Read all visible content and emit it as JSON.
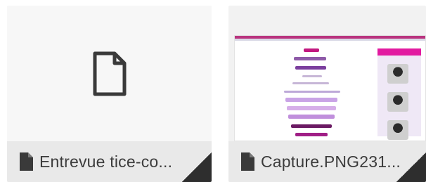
{
  "files": [
    {
      "name": "Entrevue tice-co...",
      "kind": "generic-document",
      "thumbnail_icon": "blank-file-icon",
      "type_icon": "file-icon"
    },
    {
      "name": "Capture.PNG231...",
      "kind": "image-preview",
      "thumbnail_icon": "image-preview",
      "type_icon": "file-icon"
    }
  ],
  "colors": {
    "accent_magenta": "#e21aa0",
    "dark_icon": "#2e2e2e",
    "label_text": "#3c3c3c"
  }
}
